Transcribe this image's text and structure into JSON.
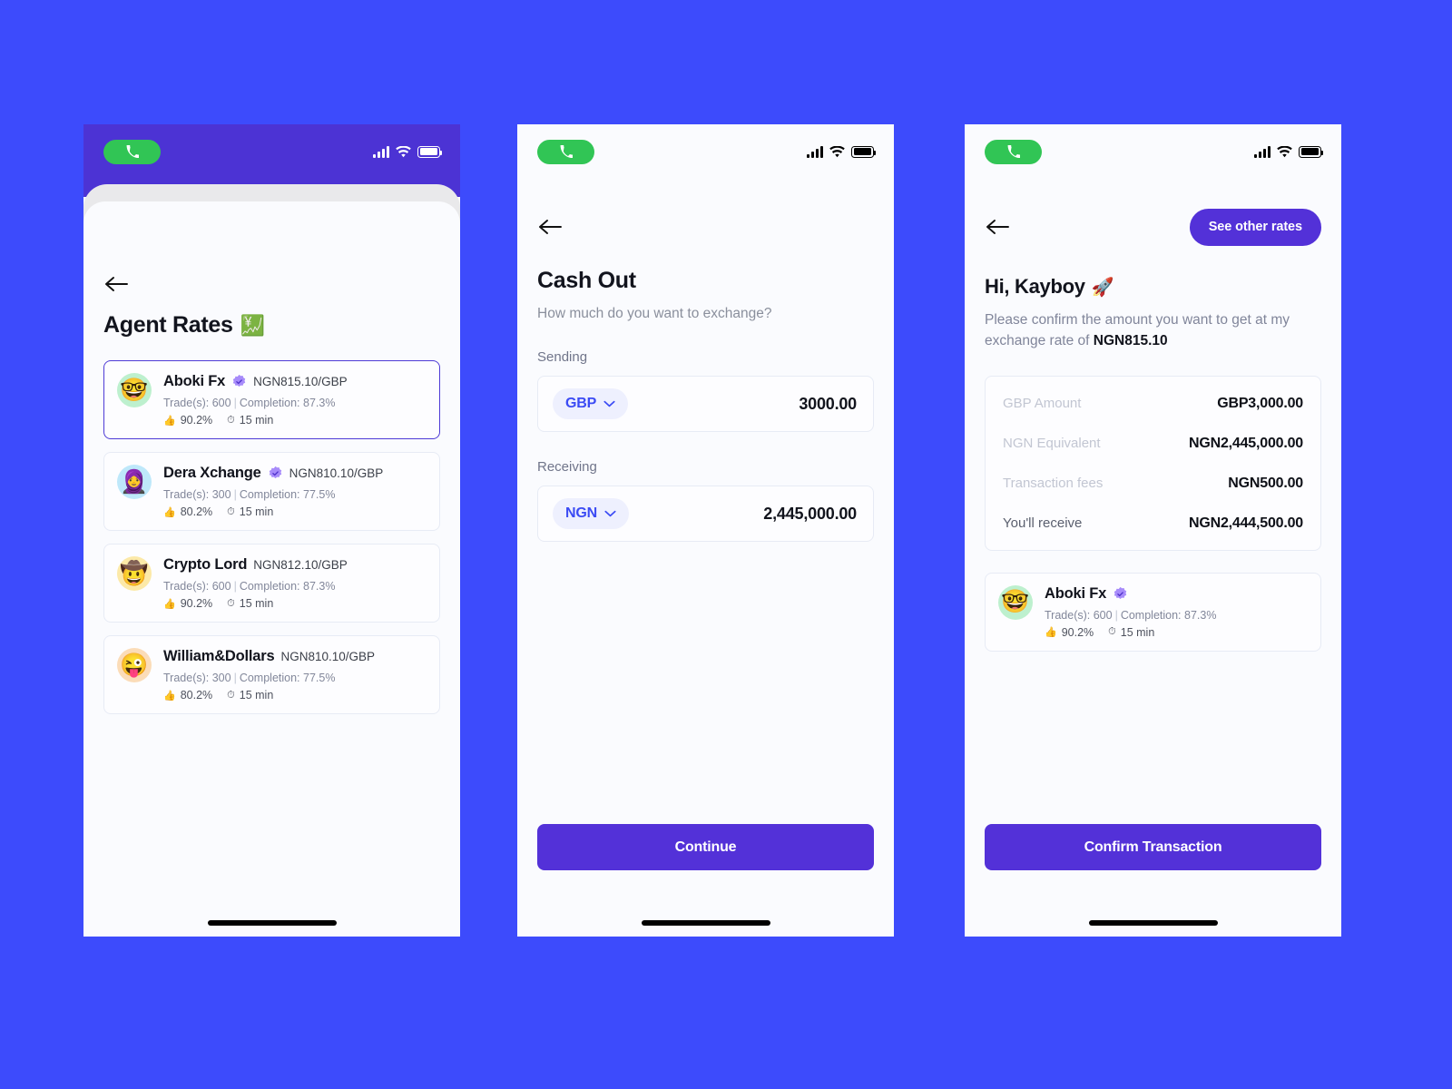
{
  "theme": {
    "background": "#3D4BFC",
    "primary": "#5331D8",
    "header_purple": "#4C33D4",
    "accent_blue": "#3B4BF4",
    "call_green": "#31C555",
    "card_border": "#E7EBF5",
    "selected_border": "#4E3BD6"
  },
  "status_bar": {
    "call_icon": "phone-icon",
    "signal_icon": "cellular-signal-icon",
    "wifi_icon": "wifi-icon",
    "battery_icon": "battery-full-icon"
  },
  "screen1": {
    "back_icon": "back-arrow-icon",
    "title": "Agent Rates",
    "title_emoji": "💹",
    "agents": [
      {
        "name": "Aboki Fx",
        "verified": true,
        "rate": "NGN815.10/GBP",
        "trades_label": "Trade(s): 600",
        "completion_label": "Completion: 87.3%",
        "thumbs_value": "90.2%",
        "time_value": "15 min",
        "avatar_emoji": "🤓",
        "avatar_color": "green",
        "selected": true
      },
      {
        "name": "Dera Xchange",
        "verified": true,
        "rate": "NGN810.10/GBP",
        "trades_label": "Trade(s): 300",
        "completion_label": "Completion: 77.5%",
        "thumbs_value": "80.2%",
        "time_value": "15 min",
        "avatar_emoji": "🧕",
        "avatar_color": "blue",
        "selected": false
      },
      {
        "name": "Crypto Lord",
        "verified": false,
        "rate": "NGN812.10/GBP",
        "trades_label": "Trade(s): 600",
        "completion_label": "Completion: 87.3%",
        "thumbs_value": "90.2%",
        "time_value": "15 min",
        "avatar_emoji": "🤠",
        "avatar_color": "yellow",
        "selected": false
      },
      {
        "name": "William&Dollars",
        "verified": false,
        "rate": "NGN810.10/GBP",
        "trades_label": "Trade(s): 300",
        "completion_label": "Completion: 77.5%",
        "thumbs_value": "80.2%",
        "time_value": "15 min",
        "avatar_emoji": "😜",
        "avatar_color": "peach",
        "selected": false
      }
    ]
  },
  "screen2": {
    "back_icon": "back-arrow-icon",
    "title": "Cash Out",
    "subtitle": "How much do you want to exchange?",
    "sending": {
      "label": "Sending",
      "currency": "GBP",
      "amount": "3000.00",
      "chevron_icon": "chevron-down-icon"
    },
    "receiving": {
      "label": "Receiving",
      "currency": "NGN",
      "amount": "2,445,000.00",
      "chevron_icon": "chevron-down-icon"
    },
    "cta_label": "Continue"
  },
  "screen3": {
    "back_icon": "back-arrow-icon",
    "see_rates_label": "See other rates",
    "greeting": "Hi, Kayboy",
    "greeting_emoji": "🚀",
    "confirm_text_lead": "Please confirm the amount you want to get at my exchange rate of ",
    "confirm_rate": "NGN815.10",
    "summary": [
      {
        "label": "GBP Amount",
        "value": "GBP3,000.00"
      },
      {
        "label": "NGN Equivalent",
        "value": "NGN2,445,000.00"
      },
      {
        "label": "Transaction fees",
        "value": "NGN500.00"
      },
      {
        "label": "You'll receive",
        "value": "NGN2,444,500.00"
      }
    ],
    "agent": {
      "name": "Aboki Fx",
      "verified": true,
      "trades_label": "Trade(s): 600",
      "completion_label": "Completion: 87.3%",
      "thumbs_value": "90.2%",
      "time_value": "15 min",
      "avatar_emoji": "🤓",
      "avatar_color": "green"
    },
    "cta_label": "Confirm Transaction"
  },
  "icons": {
    "thumbs_up": "👍",
    "clock": "⏱"
  }
}
